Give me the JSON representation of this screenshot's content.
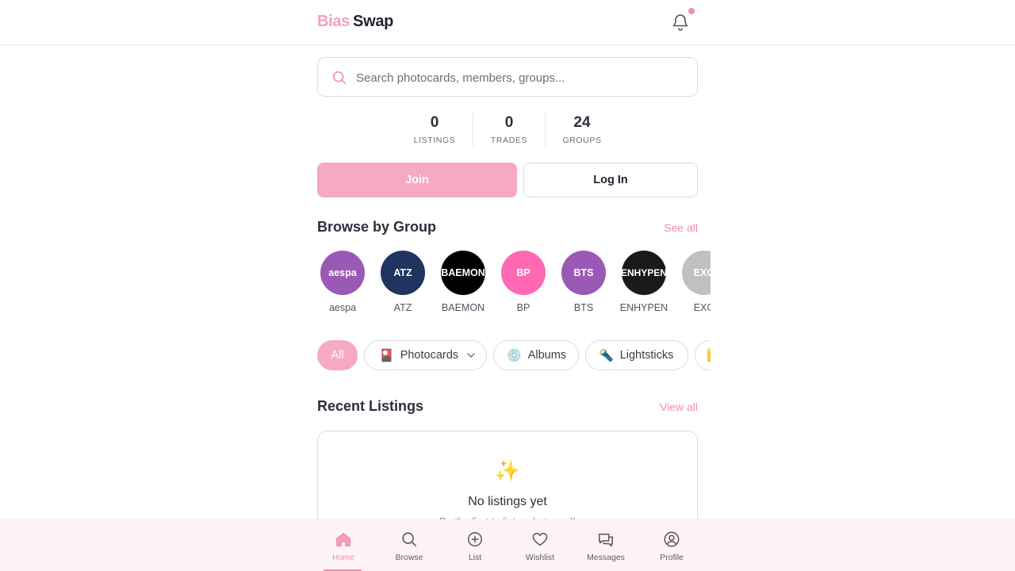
{
  "header": {
    "logo_part1": "Bias",
    "logo_part2": "Swap",
    "notification_icon": "bell-icon",
    "has_notification": true
  },
  "search": {
    "placeholder": "Search photocards, members, groups...",
    "value": ""
  },
  "stats": [
    {
      "value": "0",
      "label": "LISTINGS"
    },
    {
      "value": "0",
      "label": "TRADES"
    },
    {
      "value": "24",
      "label": "GROUPS"
    }
  ],
  "auth": {
    "join_label": "Join",
    "login_label": "Log In"
  },
  "browse_groups": {
    "title": "Browse by Group",
    "link": "See all",
    "groups": [
      {
        "badge": "aespa",
        "name": "aespa",
        "color": "#9b59b6"
      },
      {
        "badge": "ATZ",
        "name": "ATZ",
        "color": "#1f3560"
      },
      {
        "badge": "BAEMON",
        "name": "BAEMON",
        "color": "#000000"
      },
      {
        "badge": "BP",
        "name": "BP",
        "color": "#ff69b4"
      },
      {
        "badge": "BTS",
        "name": "BTS",
        "color": "#9b59b6"
      },
      {
        "badge": "ENHYPEN",
        "name": "ENHYPEN",
        "color": "#1a1a1a"
      },
      {
        "badge": "EXO",
        "name": "EXO",
        "color": "#c0c0c0"
      }
    ]
  },
  "categories": [
    {
      "label": "All",
      "icon": "",
      "active": true
    },
    {
      "label": "Photocards",
      "icon": "🎴",
      "dropdown": true
    },
    {
      "label": "Albums",
      "icon": "💿"
    },
    {
      "label": "Lightsticks",
      "icon": "🔦"
    },
    {
      "label": "",
      "icon": "🟨"
    }
  ],
  "recent_listings": {
    "title": "Recent Listings",
    "link": "View all",
    "empty_icon": "✨",
    "empty_title": "No listings yet",
    "empty_subtitle": "Be the first to list a photocard!"
  },
  "bottom_nav": [
    {
      "label": "Home",
      "icon": "home-icon",
      "active": true
    },
    {
      "label": "Browse",
      "icon": "search-icon"
    },
    {
      "label": "List",
      "icon": "plus-circle-icon"
    },
    {
      "label": "Wishlist",
      "icon": "heart-icon"
    },
    {
      "label": "Messages",
      "icon": "messages-icon"
    },
    {
      "label": "Profile",
      "icon": "profile-icon"
    }
  ],
  "colors": {
    "accent": "#f08fb0",
    "accent_light": "#f6a8c4",
    "text": "#1f2430"
  }
}
